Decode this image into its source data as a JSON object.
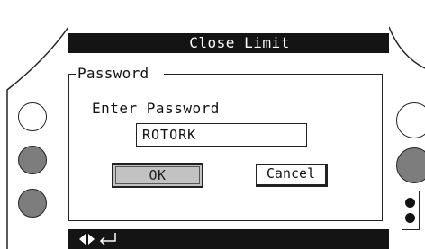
{
  "screen": {
    "title": "Close Limit"
  },
  "dialog": {
    "legend": "Password",
    "prompt": "Enter Password",
    "password_value": "ROTORK",
    "ok_label": "OK",
    "cancel_label": "Cancel"
  },
  "status_bar": {
    "icons": [
      "left-right-arrows-icon",
      "enter-return-icon"
    ]
  },
  "colors": {
    "title_bar": "#141414",
    "ok_button": "#c2c2c2",
    "side_button_grey": "#7d7d7d"
  }
}
